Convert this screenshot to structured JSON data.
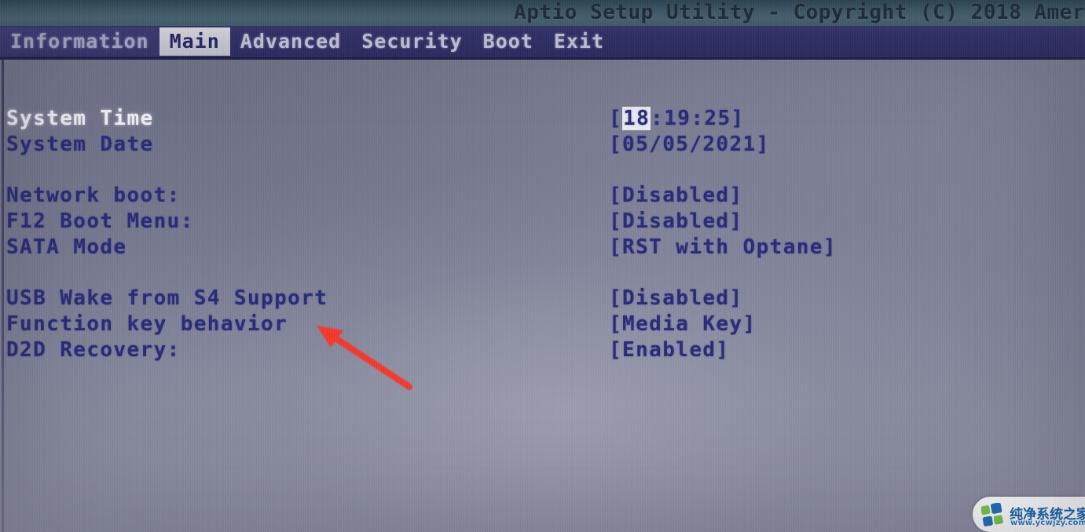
{
  "header": {
    "title": "Aptio Setup Utility - Copyright (C) 2018 Amer"
  },
  "menu": {
    "tabs": [
      {
        "label": "Information",
        "state": "dim"
      },
      {
        "label": "Main",
        "state": "active"
      },
      {
        "label": "Advanced",
        "state": "normal"
      },
      {
        "label": "Security",
        "state": "normal"
      },
      {
        "label": "Boot",
        "state": "normal"
      },
      {
        "label": "Exit",
        "state": "normal"
      }
    ]
  },
  "settings": {
    "group1": [
      {
        "label": "System Time",
        "value_prefix": "[",
        "value_highlight": "18",
        "value_suffix": ":19:25]",
        "selected": true
      },
      {
        "label": "System Date",
        "value": "[05/05/2021]",
        "selected": false
      }
    ],
    "group2": [
      {
        "label": "Network boot:",
        "value": "[Disabled]",
        "selected": false
      },
      {
        "label": "F12 Boot Menu:",
        "value": "[Disabled]",
        "selected": false
      },
      {
        "label": "SATA Mode",
        "value": "[RST with Optane]",
        "selected": false
      }
    ],
    "group3": [
      {
        "label": "USB Wake from S4 Support",
        "value": "[Disabled]",
        "selected": false
      },
      {
        "label": "Function key behavior",
        "value": "[Media Key]",
        "selected": false
      },
      {
        "label": "D2D Recovery:",
        "value": "[Enabled]",
        "selected": false
      }
    ]
  },
  "annotation": {
    "arrow_color": "#f5372a",
    "points_to": "Function key behavior"
  },
  "watermark": {
    "name_cn": "纯净系统之家",
    "url": "www.ycwjzy.com",
    "logo_colors": [
      "#7ac943",
      "#1b6fba",
      "#1b6fba",
      "#7ac943"
    ]
  },
  "colors": {
    "screen_background": "#7b7e94",
    "titlebar": "#3f5b68",
    "menubar": "#2e2d66",
    "text_blue": "#262a7a",
    "text_selected": "#eef0f6",
    "active_tab_bg": "#d6d6de"
  }
}
